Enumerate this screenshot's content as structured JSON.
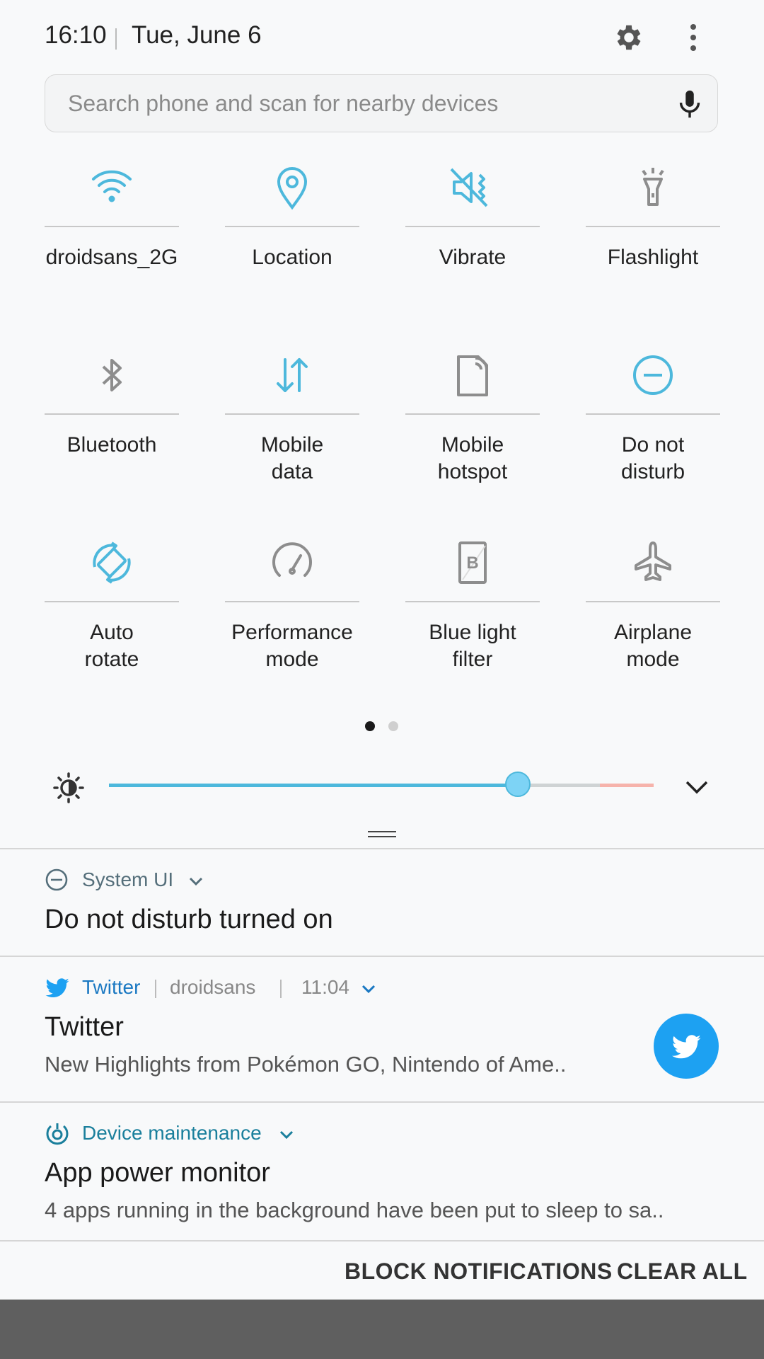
{
  "status": {
    "time": "16:10",
    "date": "Tue, June 6"
  },
  "search": {
    "placeholder": "Search phone and scan for nearby devices"
  },
  "tiles": [
    {
      "label": "droidsans_2G",
      "icon": "wifi-icon",
      "active": true
    },
    {
      "label": "Location",
      "icon": "location-icon",
      "active": true
    },
    {
      "label": "Vibrate",
      "icon": "vibrate-icon",
      "active": true
    },
    {
      "label": "Flashlight",
      "icon": "flashlight-icon",
      "active": false
    },
    {
      "label": "Bluetooth",
      "icon": "bluetooth-icon",
      "active": false
    },
    {
      "label": "Mobile\ndata",
      "icon": "mobile-data-icon",
      "active": true
    },
    {
      "label": "Mobile\nhotspot",
      "icon": "hotspot-icon",
      "active": false
    },
    {
      "label": "Do not\ndisturb",
      "icon": "do-not-disturb-icon",
      "active": true
    },
    {
      "label": "Auto\nrotate",
      "icon": "auto-rotate-icon",
      "active": true
    },
    {
      "label": "Performance\nmode",
      "icon": "performance-icon",
      "active": false
    },
    {
      "label": "Blue light\nfilter",
      "icon": "blue-light-filter-icon",
      "active": false
    },
    {
      "label": "Airplane\nmode",
      "icon": "airplane-icon",
      "active": false
    }
  ],
  "pager": {
    "current": 1,
    "total": 2
  },
  "brightness": {
    "level": 0.75
  },
  "colors": {
    "accent": "#4db8dc",
    "knob": "#7dd3f5",
    "twitter": "#1da1f2",
    "maintenance": "#1a7f9c"
  },
  "notifications": {
    "system_ui": {
      "app": "System UI",
      "title": "Do not disturb turned on"
    },
    "twitter": {
      "app": "Twitter",
      "account": "droidsans",
      "time": "11:04",
      "title": "Twitter",
      "text": "New Highlights from Pokémon GO, Nintendo of Ame.."
    },
    "maintenance": {
      "app": "Device maintenance",
      "title": "App power monitor",
      "text": "4 apps running in the background have been put to sleep to sa.."
    }
  },
  "actions": {
    "block": "BLOCK NOTIFICATIONS",
    "clear": "CLEAR ALL"
  }
}
